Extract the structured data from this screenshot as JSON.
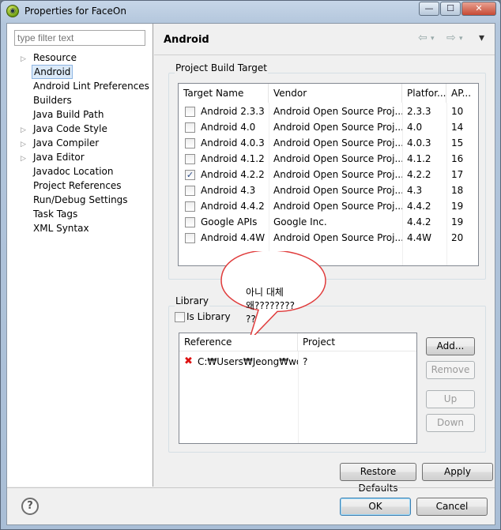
{
  "window": {
    "title": "Properties for FaceOn",
    "min": "—",
    "max": "☐",
    "close": "✕"
  },
  "filter": {
    "placeholder": "type filter text"
  },
  "tree": [
    {
      "label": "Resource",
      "expandable": true
    },
    {
      "label": "Android",
      "expandable": false,
      "selected": true
    },
    {
      "label": "Android Lint Preferences",
      "expandable": false
    },
    {
      "label": "Builders",
      "expandable": false
    },
    {
      "label": "Java Build Path",
      "expandable": false
    },
    {
      "label": "Java Code Style",
      "expandable": true
    },
    {
      "label": "Java Compiler",
      "expandable": true
    },
    {
      "label": "Java Editor",
      "expandable": true
    },
    {
      "label": "Javadoc Location",
      "expandable": false
    },
    {
      "label": "Project References",
      "expandable": false
    },
    {
      "label": "Run/Debug Settings",
      "expandable": false
    },
    {
      "label": "Task Tags",
      "expandable": false
    },
    {
      "label": "XML Syntax",
      "expandable": false
    }
  ],
  "page": {
    "title": "Android",
    "back_icon": "⇦",
    "fwd_icon": "⇨",
    "menu_icon": "▾"
  },
  "build_target": {
    "group_label": "Project Build Target",
    "headers": [
      "Target Name",
      "Vendor",
      "Platfor...",
      "AP..."
    ],
    "rows": [
      {
        "checked": false,
        "name": "Android 2.3.3",
        "vendor": "Android Open Source Proj...",
        "platform": "2.3.3",
        "api": "10"
      },
      {
        "checked": false,
        "name": "Android 4.0",
        "vendor": "Android Open Source Proj...",
        "platform": "4.0",
        "api": "14"
      },
      {
        "checked": false,
        "name": "Android 4.0.3",
        "vendor": "Android Open Source Proj...",
        "platform": "4.0.3",
        "api": "15"
      },
      {
        "checked": false,
        "name": "Android 4.1.2",
        "vendor": "Android Open Source Proj...",
        "platform": "4.1.2",
        "api": "16"
      },
      {
        "checked": true,
        "name": "Android 4.2.2",
        "vendor": "Android Open Source Proj...",
        "platform": "4.2.2",
        "api": "17"
      },
      {
        "checked": false,
        "name": "Android 4.3",
        "vendor": "Android Open Source Proj...",
        "platform": "4.3",
        "api": "18"
      },
      {
        "checked": false,
        "name": "Android 4.4.2",
        "vendor": "Android Open Source Proj...",
        "platform": "4.4.2",
        "api": "19"
      },
      {
        "checked": false,
        "name": "Google APIs",
        "vendor": "Google Inc.",
        "platform": "4.4.2",
        "api": "19"
      },
      {
        "checked": false,
        "name": "Android 4.4W",
        "vendor": "Android Open Source Proj...",
        "platform": "4.4W",
        "api": "20"
      }
    ]
  },
  "library": {
    "group_label": "Library",
    "is_library_label": "Is Library",
    "is_library_checked": false,
    "headers": [
      "Reference",
      "Project"
    ],
    "rows": [
      {
        "error_icon": "✖",
        "reference": "C:₩Users₩Jeong₩wo...",
        "project": "?"
      }
    ],
    "buttons": {
      "add": "Add...",
      "remove": "Remove",
      "up": "Up",
      "down": "Down"
    }
  },
  "annotation": {
    "line1": "아니 대체",
    "line2": "왜????????",
    "line3": "??"
  },
  "footer": {
    "restore_defaults": "Restore Defaults",
    "apply": "Apply",
    "ok": "OK",
    "cancel": "Cancel",
    "help_icon": "?"
  }
}
